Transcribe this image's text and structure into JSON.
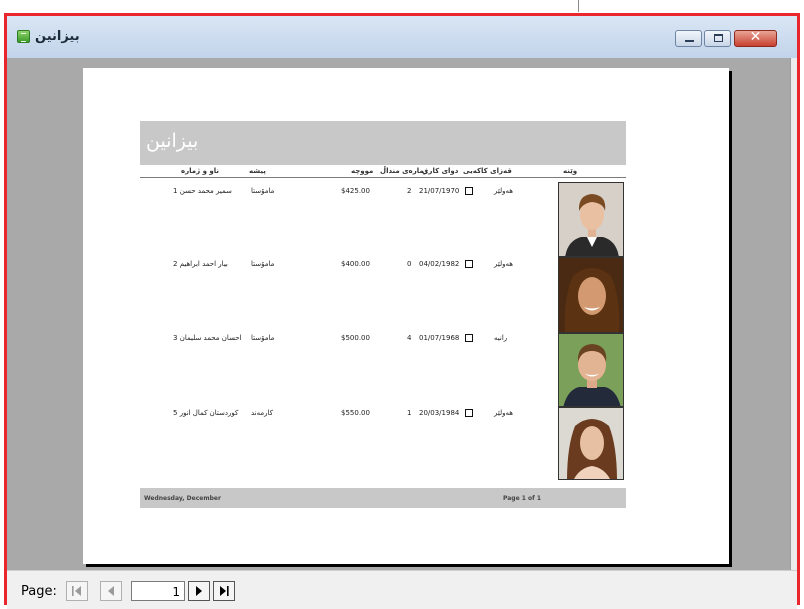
{
  "window": {
    "title": "بيزانين",
    "icon": "report-icon",
    "controls": {
      "minimize": "minimize-icon",
      "maximize": "maximize-icon",
      "close_label": "✕"
    }
  },
  "report": {
    "title": "بيزانين",
    "columns": {
      "photo": "وێنه",
      "department": "قه‌زای کاکه‌یی",
      "dob_married": "دوای کاری",
      "children": "ژمارەی منداڵ",
      "salary": "مووچه",
      "job": "پیشه",
      "name": "ناو و ژماره"
    },
    "rows": [
      {
        "name": "سمیر محمد حسن 1",
        "job": "مامۆستا",
        "salary": "$425.00",
        "children": "2",
        "date": "21/07/1970",
        "city": "هەولێر"
      },
      {
        "name": "بیار احمد ابراهیم 2",
        "job": "مامۆستا",
        "salary": "$400.00",
        "children": "0",
        "date": "04/02/1982",
        "city": "هەولێر"
      },
      {
        "name": "احسان محمد سلیمان 3",
        "job": "مامۆستا",
        "salary": "$500.00",
        "children": "4",
        "date": "01/07/1968",
        "city": "رانیه"
      },
      {
        "name": "کوردستان کمال انور 5",
        "job": "کارمەند",
        "salary": "$550.00",
        "children": "1",
        "date": "20/03/1984",
        "city": "هەولێر"
      }
    ],
    "footer": {
      "date": "Wednesday, December",
      "page": "Page 1 of 1"
    }
  },
  "statusbar": {
    "page_label": "Page:",
    "page_value": "1"
  },
  "colors": {
    "frame_border": "#e8262c",
    "titlebar": "#cfdcef",
    "canvas": "#a9a9a9",
    "report_band": "#c8c8c8"
  }
}
